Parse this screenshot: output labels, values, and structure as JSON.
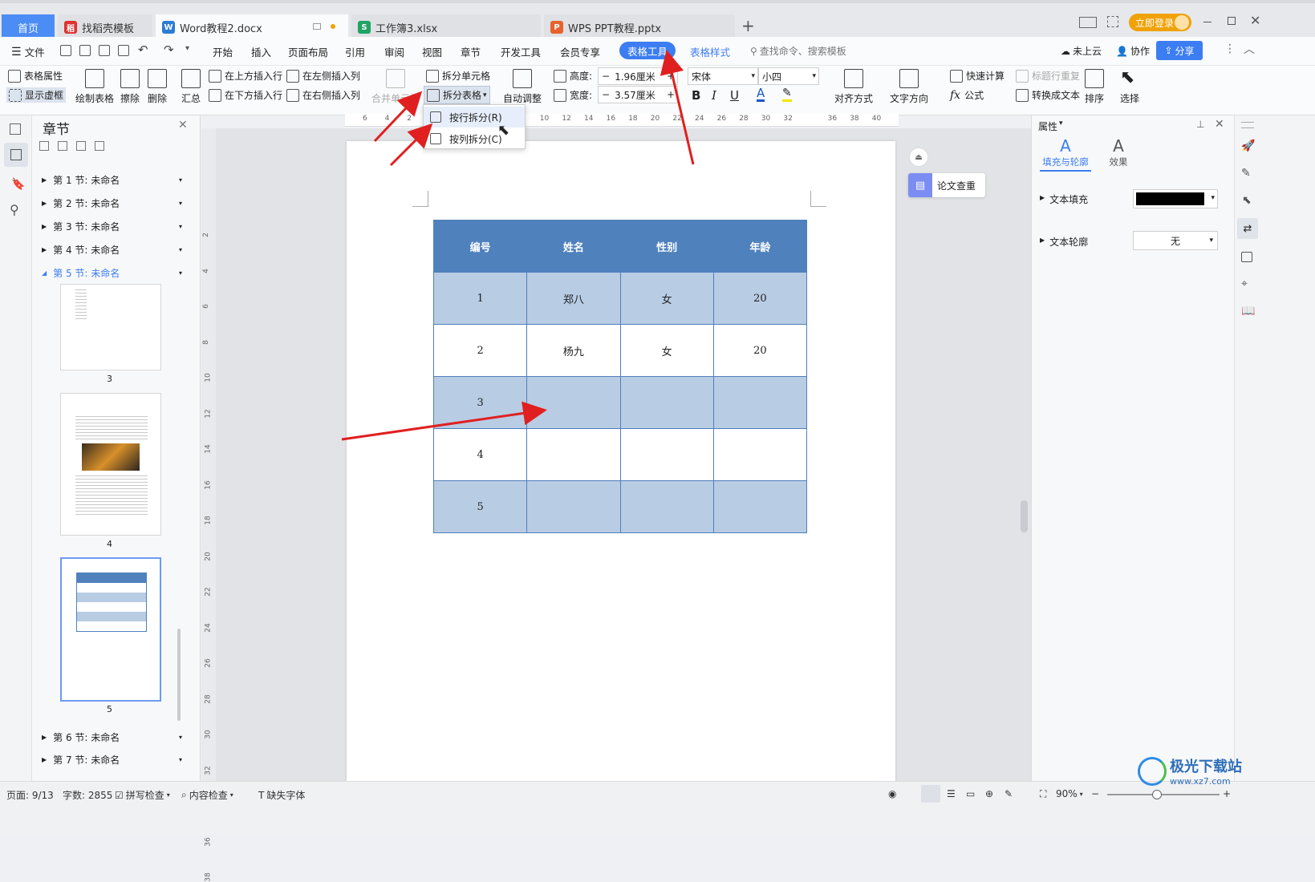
{
  "colors": {
    "accent": "#3c7df2",
    "table_header": "#4f81bd",
    "table_band": "#b8cce4",
    "login": "#f0a20a",
    "arrow": "#e02020"
  },
  "tabs": [
    {
      "label": "首页",
      "icon": "home-icon"
    },
    {
      "label": "找稻壳模板",
      "icon": "docer-icon"
    },
    {
      "label": "Word教程2.docx",
      "icon": "word-icon"
    },
    {
      "label": "工作簿3.xlsx",
      "icon": "excel-icon"
    },
    {
      "label": "WPS PPT教程.pptx",
      "icon": "ppt-icon"
    }
  ],
  "login_label": "立即登录",
  "menu": {
    "file": "文件",
    "items": [
      "开始",
      "插入",
      "页面布局",
      "引用",
      "审阅",
      "视图",
      "章节",
      "开发工具",
      "会员专享",
      "表格工具",
      "表格样式"
    ],
    "search_placeholder": "查找命令、搜索模板",
    "cloud": "未上云",
    "collab": "协作",
    "share": "分享"
  },
  "ribbon": {
    "table_props": "表格属性",
    "show_grid": "显示虚框",
    "draw_table": "绘制表格",
    "erase": "擦除",
    "delete": "删除",
    "summary": "汇总",
    "ins_above": "在上方插入行",
    "ins_below": "在下方插入行",
    "ins_left": "在左侧插入列",
    "ins_right": "在右侧插入列",
    "merge": "合并单元格",
    "split_cell": "拆分单元格",
    "split_table": "拆分表格",
    "auto_fit": "自动调整",
    "height_label": "高度:",
    "height_value": "1.96厘米",
    "width_label": "宽度:",
    "width_value": "3.57厘米",
    "font_name": "宋体",
    "font_size": "小四",
    "align": "对齐方式",
    "text_dir": "文字方向",
    "quick_calc": "快速计算",
    "repeat_title": "标题行重复",
    "formula": "公式",
    "to_text": "转换成文本",
    "sort": "排序",
    "select": "选择"
  },
  "dropdown": {
    "by_row": "按行拆分(R)",
    "by_col": "按列拆分(C)"
  },
  "nav": {
    "title": "章节",
    "sections": [
      "第 1 节: 未命名",
      "第 2 节: 未命名",
      "第 3 节: 未命名",
      "第 4 节: 未命名",
      "第 5 节: 未命名"
    ],
    "sections_after": [
      "第 6 节: 未命名",
      "第 7 节: 未命名"
    ],
    "page_numbers": [
      "3",
      "4",
      "5"
    ]
  },
  "ruler_h": [
    "6",
    "4",
    "2",
    "",
    "2",
    "4",
    "6",
    "8",
    "10",
    "12",
    "14",
    "16",
    "18",
    "20",
    "22",
    "24",
    "26",
    "28",
    "30",
    "32",
    "",
    "36",
    "38",
    "40"
  ],
  "ruler_v": [
    "2",
    "4",
    "6",
    "8",
    "10",
    "12",
    "14",
    "16",
    "18",
    "20",
    "22",
    "24",
    "26",
    "28",
    "30",
    "32",
    "34",
    "36",
    "38"
  ],
  "table": {
    "headers": [
      "编号",
      "姓名",
      "性别",
      "年龄"
    ],
    "rows": [
      [
        "1",
        "郑八",
        "女",
        "20"
      ],
      [
        "2",
        "杨九",
        "女",
        "20"
      ],
      [
        "3",
        "",
        "",
        ""
      ],
      [
        "4",
        "",
        "",
        ""
      ],
      [
        "5",
        "",
        "",
        ""
      ]
    ]
  },
  "paper_check": "论文查重",
  "props": {
    "title": "属性",
    "tab_fill": "填充与轮廓",
    "tab_effect": "效果",
    "text_fill": "文本填充",
    "text_outline": "文本轮廓",
    "outline_value": "无"
  },
  "status": {
    "page": "页面: 9/13",
    "words": "字数: 2855",
    "spell": "拼写检查",
    "content": "内容检查",
    "missing_font": "缺失字体",
    "zoom": "90%"
  },
  "watermark": {
    "text": "极光下载站",
    "url": "www.xz7.com"
  }
}
